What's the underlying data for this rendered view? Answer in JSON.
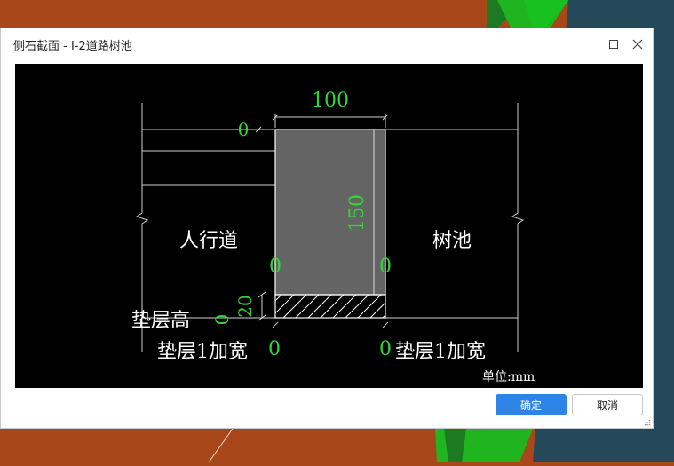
{
  "window": {
    "title": "侧石截面 - I-2道路树池"
  },
  "drawing": {
    "top_width": "100",
    "height": "150",
    "top_offset": "0",
    "left_offset": "0",
    "right_offset": "0",
    "cushion_height_value": "20",
    "cushion_height_zero": "0",
    "left_label": "人行道",
    "right_label": "树池",
    "cushion_height_label": "垫层高",
    "cushion_left_label": "垫层1加宽",
    "cushion_left_value": "0",
    "cushion_right_value": "0",
    "cushion_right_label": "垫层1加宽",
    "unit_label": "单位:mm"
  },
  "buttons": {
    "ok": "确定",
    "cancel": "取消"
  },
  "colors": {
    "accent": "#2d84e6",
    "dim_green": "#33d633",
    "curb_fill": "#646464"
  },
  "icons": {
    "maximize": "maximize-icon",
    "close": "close-icon",
    "resize": "resize-grip-icon"
  }
}
